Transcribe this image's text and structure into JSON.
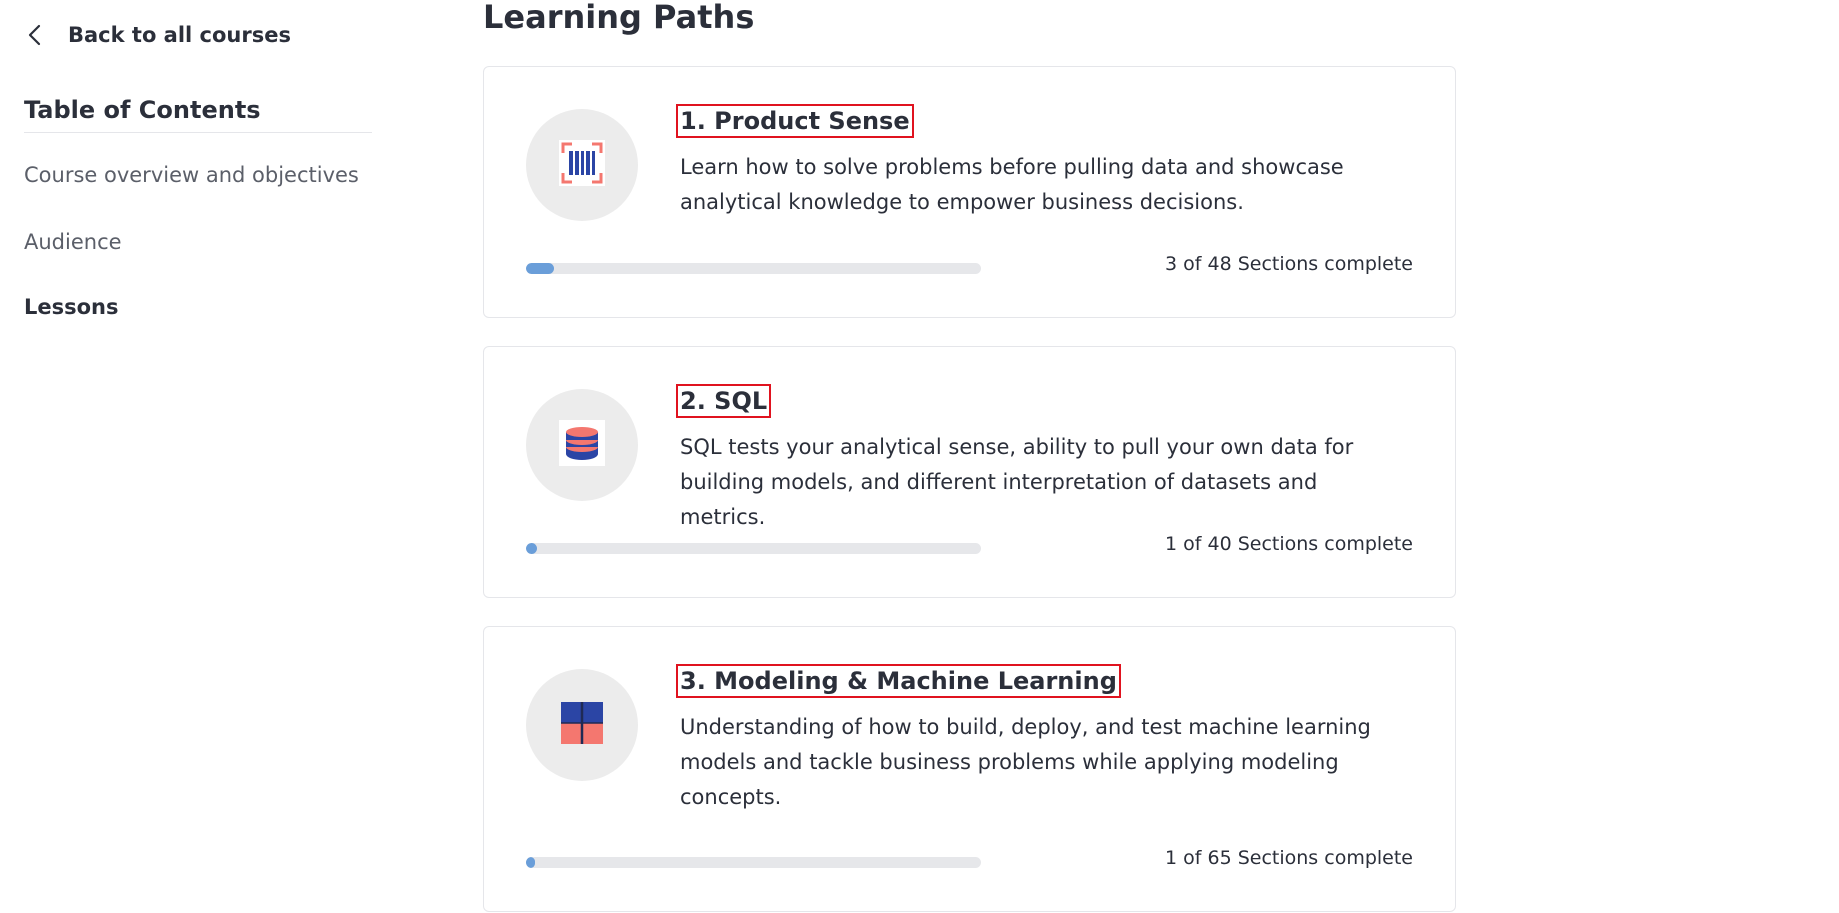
{
  "sidebar": {
    "back_label": "Back to all courses",
    "toc_title": "Table of Contents",
    "items": [
      {
        "label": "Course overview and objectives",
        "active": false
      },
      {
        "label": "Audience",
        "active": false
      },
      {
        "label": "Lessons",
        "active": true
      }
    ]
  },
  "main": {
    "title": "Learning Paths",
    "paths": [
      {
        "title": "1. Product Sense",
        "description": "Learn how to solve problems before pulling data and showcase analytical knowledge to empower business decisions.",
        "progress_text": "3 of 48 Sections complete",
        "completed": 3,
        "total": 48,
        "icon": "barcode-scan-icon"
      },
      {
        "title": "2. SQL",
        "description": "SQL tests your analytical sense, ability to pull your own data for building models, and different interpretation of datasets and metrics.",
        "progress_text": "1 of 40 Sections complete",
        "completed": 1,
        "total": 40,
        "icon": "database-icon"
      },
      {
        "title": "3. Modeling & Machine Learning",
        "description": "Understanding of how to build, deploy, and test machine learning models and tackle business problems while applying modeling concepts.",
        "progress_text": "1 of 65 Sections complete",
        "completed": 1,
        "total": 65,
        "icon": "grid-blocks-icon"
      }
    ]
  },
  "colors": {
    "accent_blue": "#6a9ed9",
    "highlight_red": "#e0131f",
    "icon_blue": "#2b45a5",
    "icon_coral": "#f4776f",
    "track_gray": "#e6e7ea",
    "circle_gray": "#ececec"
  }
}
